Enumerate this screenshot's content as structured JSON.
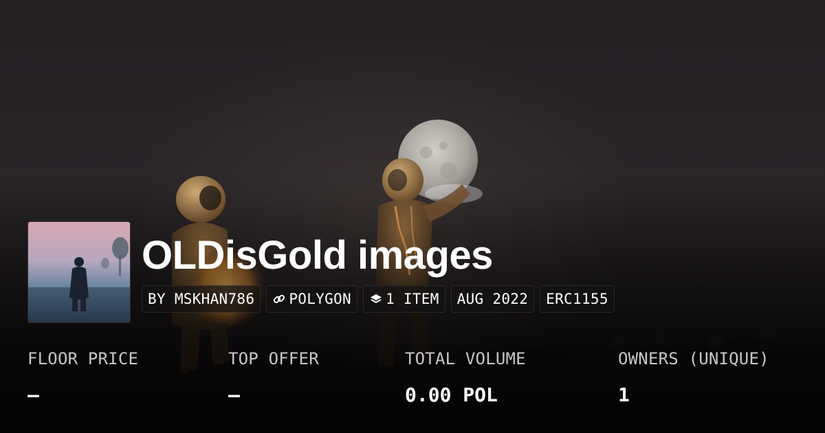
{
  "collection": {
    "title": "OLDisGold images",
    "chips": {
      "creator": "BY MSKHAN786",
      "chain": "POLYGON",
      "items": "1 ITEM",
      "created": "AUG 2022",
      "standard": "ERC1155"
    }
  },
  "stats": {
    "floor_price": {
      "label": "FLOOR PRICE",
      "value": "–"
    },
    "top_offer": {
      "label": "TOP OFFER",
      "value": "–"
    },
    "total_volume": {
      "label": "TOTAL VOLUME",
      "value": "0.00 POL"
    },
    "owners": {
      "label": "OWNERS (UNIQUE)",
      "value": "1"
    }
  },
  "icons": {
    "chain": "link-icon",
    "items": "layers-icon"
  },
  "colors": {
    "background": "#241f23",
    "text": "#ffffff",
    "label": "#c9c6c9",
    "suit_glow": "#c98a3a"
  }
}
